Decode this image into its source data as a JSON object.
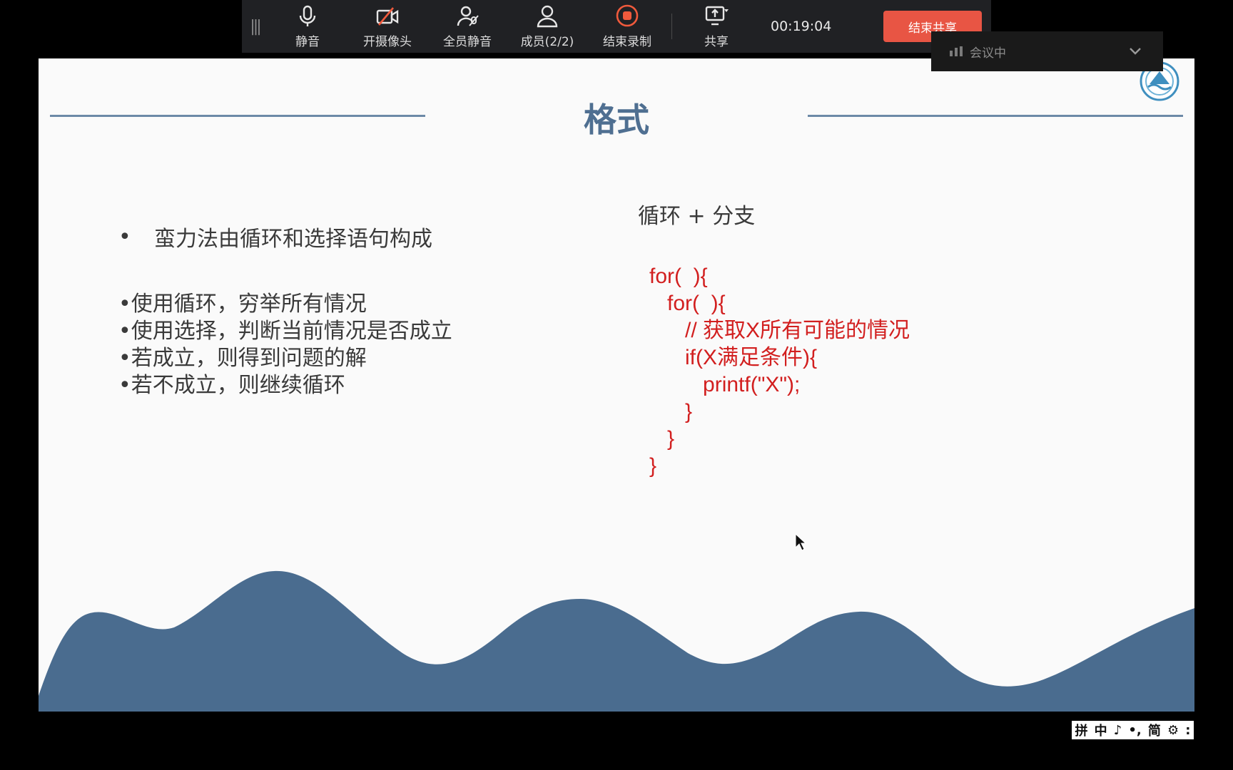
{
  "toolbar": {
    "grip": "|||",
    "mute_label": "静音",
    "camera_label": "开摄像头",
    "mute_all_label": "全员静音",
    "members_label": "成员(2/2)",
    "end_record_label": "结束录制",
    "share_label": "共享",
    "timer": "00:19:04",
    "end_share_label": "结束共享"
  },
  "meeting_status": {
    "text": "会议中"
  },
  "slide": {
    "title": "格式",
    "lead": "蛮力法由循环和选择语句构成",
    "points": [
      "使用循环，穷举所有情况",
      "使用选择，判断当前情况是否成立",
      "若成立，则得到问题的解",
      "若不成立，则继续循环"
    ],
    "right_heading": "循环 + 分支",
    "code_lines": [
      "for(  ){",
      "   for(  ){",
      "      // 获取X所有可能的情况",
      "      if(X满足条件){",
      "         printf(\"X\");",
      "      }",
      "   }",
      "}"
    ]
  },
  "ime": {
    "items": [
      "拼",
      "中",
      "♪",
      "•,",
      "简",
      "⚙",
      ":"
    ]
  },
  "colors": {
    "title": "#4f6f91",
    "rule": "#6c89a7",
    "wave": "#4a6c8f",
    "code": "#d21f1f",
    "end_share": "#e85544",
    "record": "#f05a3c"
  }
}
